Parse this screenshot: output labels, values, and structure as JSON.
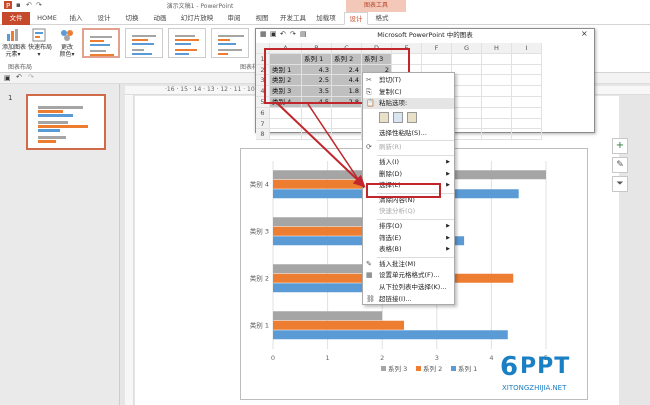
{
  "window": {
    "title": "演示文稿1 - PowerPoint",
    "context_tab": "图表工具"
  },
  "tabs": [
    "文件",
    "HOME",
    "插入",
    "设计",
    "切换",
    "动画",
    "幻灯片放映",
    "审阅",
    "视图",
    "开发工具",
    "加载项",
    "设计",
    "格式"
  ],
  "ribbon": {
    "add_element": "添加图表\n元素▾",
    "quick_layout": "快速布局\n▾",
    "change_color": "更改\n颜色▾",
    "group_layout": "图表布局",
    "group_styles": "图表样"
  },
  "slide_panel": {
    "slide_number": "1"
  },
  "ruler_text": "·16 · 15 · 14 · 13 · 12 · 11 · 10 · 9 · 8 · 7 · 6 · 5 · 4 · 3 · 2 · 1 · 0 · 1 · 2 · 3 · 4 · 5 · 6 · 7 · 8 · 9 · 10 ·",
  "datasheet": {
    "title": "Microsoft PowerPoint 中的图表",
    "columns": [
      "",
      "A",
      "B",
      "C",
      "D",
      "E",
      "F",
      "G",
      "H",
      "I"
    ],
    "rows": [
      [
        "1",
        "",
        "系列 1",
        "系列 2",
        "系列 3",
        "",
        "",
        "",
        "",
        ""
      ],
      [
        "2",
        "类别 1",
        "4.3",
        "2.4",
        "2",
        "",
        "",
        "",
        "",
        ""
      ],
      [
        "3",
        "类别 2",
        "2.5",
        "4.4",
        "",
        "",
        "",
        "",
        "",
        ""
      ],
      [
        "4",
        "类别 3",
        "3.5",
        "1.8",
        "",
        "",
        "",
        "",
        "",
        ""
      ],
      [
        "5",
        "类别 4",
        "4.5",
        "2.8",
        "",
        "",
        "",
        "",
        "",
        ""
      ],
      [
        "6",
        "",
        "",
        "",
        "",
        "",
        "",
        "",
        "",
        ""
      ],
      [
        "7",
        "",
        "",
        "",
        "",
        "",
        "",
        "",
        "",
        ""
      ],
      [
        "8",
        "",
        "",
        "",
        "",
        "",
        "",
        "",
        "",
        ""
      ]
    ]
  },
  "context_menu": {
    "items": [
      {
        "label": "剪切(T)",
        "disabled": false,
        "sub": false
      },
      {
        "label": "复制(C)",
        "disabled": false,
        "sub": false
      },
      {
        "label": "粘贴选项:",
        "disabled": false,
        "sub": false
      },
      {
        "label": "",
        "disabled": false,
        "sub": false
      },
      {
        "label": "选择性粘贴(S)...",
        "disabled": false,
        "sub": false
      },
      {
        "label": "刷新(R)",
        "disabled": true,
        "sub": false
      },
      {
        "label": "插入(I)",
        "disabled": false,
        "sub": true
      },
      {
        "label": "删除(D)",
        "disabled": false,
        "sub": true
      },
      {
        "label": "选择(L)",
        "disabled": false,
        "sub": true
      },
      {
        "label": "清除内容(N)",
        "disabled": false,
        "sub": false
      },
      {
        "label": "快速分析(Q)",
        "disabled": true,
        "sub": false
      },
      {
        "label": "排序(O)",
        "disabled": false,
        "sub": true
      },
      {
        "label": "筛选(E)",
        "disabled": false,
        "sub": true
      },
      {
        "label": "表格(B)",
        "disabled": false,
        "sub": true
      },
      {
        "label": "插入批注(M)",
        "disabled": false,
        "sub": false
      },
      {
        "label": "设置单元格格式(F)...",
        "disabled": false,
        "sub": false
      },
      {
        "label": "从下拉列表中选择(K)...",
        "disabled": false,
        "sub": false
      },
      {
        "label": "超链接(I)...",
        "disabled": false,
        "sub": false
      }
    ]
  },
  "chart_data": {
    "type": "bar",
    "orientation": "horizontal",
    "categories": [
      "类别 1",
      "类别 2",
      "类别 3",
      "类别 4"
    ],
    "series": [
      {
        "name": "系列 1",
        "color": "#5b9bd5",
        "values": [
          4.3,
          2.5,
          3.5,
          4.5
        ]
      },
      {
        "name": "系列 2",
        "color": "#ed7d31",
        "values": [
          2.4,
          4.4,
          1.8,
          2.8
        ]
      },
      {
        "name": "系列 3",
        "color": "#a5a5a5",
        "values": [
          2,
          2,
          3,
          5
        ]
      }
    ],
    "xlim": [
      0,
      5
    ],
    "xticks": [
      "0",
      "1",
      "2",
      "3",
      "4",
      "5"
    ],
    "legend": "bottom-right",
    "grid": true
  },
  "watermark": {
    "brand": "PPT",
    "sub": "XITONGZHIJIA.NET",
    "numeral": "6"
  },
  "colors": {
    "accent": "#c5492a",
    "annotation": "#c0262c"
  }
}
